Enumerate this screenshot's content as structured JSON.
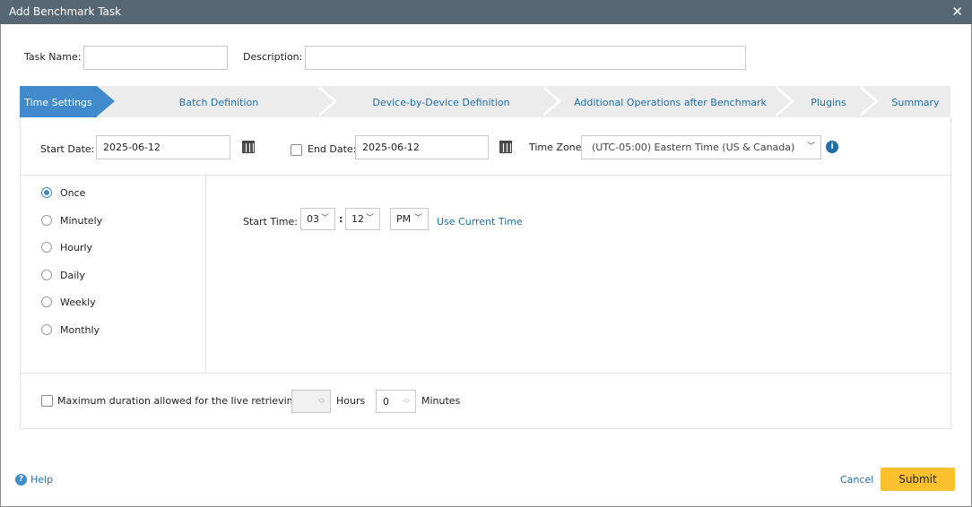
{
  "dialog": {
    "title": "Add Benchmark Task",
    "close_icon": "close-icon"
  },
  "task": {
    "name_label": "Task Name:",
    "name_value": "",
    "description_label": "Description:",
    "description_value": ""
  },
  "tabs": [
    {
      "label": "Time Settings",
      "active": true
    },
    {
      "label": "Batch Definition"
    },
    {
      "label": "Device-by-Device Definition"
    },
    {
      "label": "Additional Operations after Benchmark"
    },
    {
      "label": "Plugins"
    },
    {
      "label": "Summary"
    }
  ],
  "dates": {
    "start_label": "Start Date:",
    "start_value": "2025-06-12",
    "end_label": "End Date:",
    "end_value": "2025-06-12",
    "end_enabled": false,
    "timezone_label": "Time Zone:",
    "timezone_value": "(UTC-05:00) Eastern Time (US & Canada)"
  },
  "frequency": {
    "selected": "Once",
    "options": [
      "Once",
      "Minutely",
      "Hourly",
      "Daily",
      "Weekly",
      "Monthly"
    ]
  },
  "start_time": {
    "label": "Start Time:",
    "hour": "03",
    "separator": ":",
    "minute": "12",
    "ampm": "PM",
    "use_current": "Use Current Time"
  },
  "duration": {
    "label": "Maximum duration allowed for the live retrieving:",
    "checked": false,
    "hours_value": "",
    "hours_label": "Hours",
    "minutes_value": "0",
    "minutes_label": "Minutes"
  },
  "footer": {
    "help": "Help",
    "cancel": "Cancel",
    "submit": "Submit"
  },
  "colors": {
    "titlebar": "#566773",
    "accent": "#3f8bcb",
    "submit": "#fcc02e",
    "link": "#1f6fa8"
  }
}
